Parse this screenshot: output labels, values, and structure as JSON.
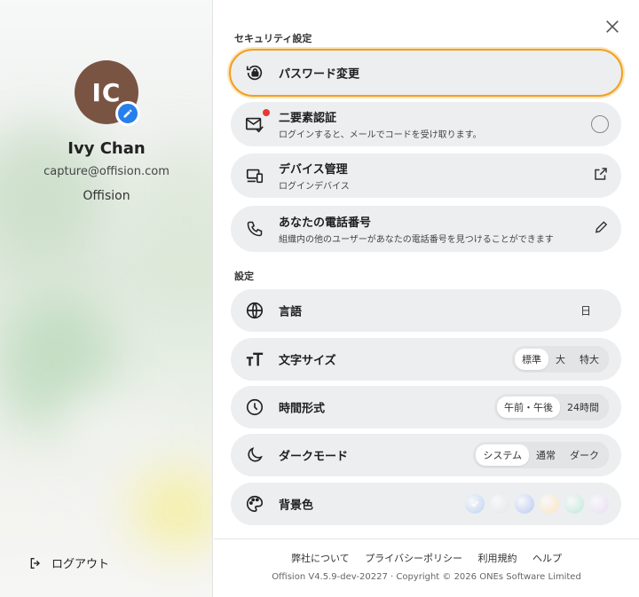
{
  "profile": {
    "initials": "IC",
    "name": "Ivy Chan",
    "email": "capture@offision.com",
    "organization": "Offision",
    "logout_label": "ログアウト"
  },
  "security": {
    "section_title": "セキュリティ設定",
    "password": {
      "title": "パスワード変更"
    },
    "two_factor": {
      "title": "二要素認証",
      "subtitle": "ログインすると、メールでコードを受け取ります。"
    },
    "devices": {
      "title": "デバイス管理",
      "subtitle": "ログインデバイス"
    },
    "phone": {
      "title": "あなたの電話番号",
      "subtitle": "組織内の他のユーザーがあなたの電話番号を見つけることができます"
    }
  },
  "settings": {
    "section_title": "設定",
    "language": {
      "title": "言語",
      "value": "日"
    },
    "font_size": {
      "title": "文字サイズ",
      "options": [
        "標準",
        "大",
        "特大"
      ],
      "selected": "標準"
    },
    "time_format": {
      "title": "時間形式",
      "options": [
        "午前・午後",
        "24時間"
      ],
      "selected": "午前・午後"
    },
    "dark_mode": {
      "title": "ダークモード",
      "options": [
        "システム",
        "通常",
        "ダーク"
      ],
      "selected": "システム"
    },
    "background": {
      "title": "背景色",
      "colors": [
        "#bcd3f0",
        "#e4e5e8",
        "#b9c8f4",
        "#fbe4bf",
        "#bfe8d8",
        "#eadcf5"
      ],
      "selected_index": 0
    }
  },
  "footer": {
    "links": [
      "弊社について",
      "プライバシーポリシー",
      "利用規約",
      "ヘルプ"
    ],
    "version": "Offision V4.5.9-dev-20227 · Copyright © 2026 ONEs Software Limited"
  },
  "colors": {
    "accent_blue": "#2680eb",
    "focus_orange": "#f0a020",
    "notification_red": "#e53935",
    "avatar_bg": "#7a5443"
  }
}
